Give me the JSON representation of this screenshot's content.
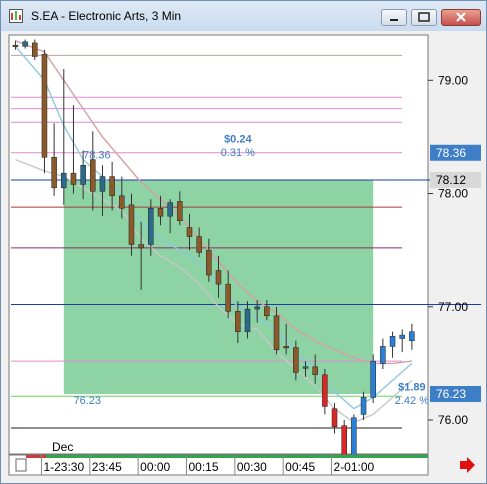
{
  "window": {
    "title": "S.EA - Electronic Arts, 3 Min",
    "minimize_icon": "minimize-icon",
    "maximize_icon": "maximize-icon",
    "close_icon": "close-icon"
  },
  "chart_data": {
    "type": "candlestick",
    "title": "S.EA - Electronic Arts, 3 Min",
    "ylim": [
      75.7,
      79.4
    ],
    "y_ticks": [
      79.0,
      78.0,
      77.0,
      76.0
    ],
    "y_tick_labels": [
      "79.00",
      "78.00",
      "77.00",
      "76.00"
    ],
    "x_labels": [
      "1-23:30",
      "23:45",
      "00:00",
      "00:15",
      "00:30",
      "00:45",
      "2-01:00"
    ],
    "x_label_positions": [
      0,
      15,
      30,
      45,
      60,
      75,
      90
    ],
    "month_label": "Dec",
    "price_badges": [
      {
        "label": "78.36",
        "value": 78.36,
        "color": "#3d7ec6",
        "text_color": "#ffffff"
      },
      {
        "label": "78.12",
        "value": 78.12,
        "color": "#d8d8d8",
        "text_color": "#000000"
      },
      {
        "label": "76.23",
        "value": 76.23,
        "color": "#3d7ec6",
        "text_color": "#ffffff"
      }
    ],
    "horizontal_lines": [
      {
        "value": 79.22,
        "color": "#c0a0a0"
      },
      {
        "value": 78.85,
        "color": "#e08ad0"
      },
      {
        "value": 78.75,
        "color": "#e08ad0"
      },
      {
        "value": 78.63,
        "color": "#e08ad0"
      },
      {
        "value": 78.36,
        "color": "#e08ad0"
      },
      {
        "value": 78.12,
        "color": "#1c3aa8"
      },
      {
        "value": 77.88,
        "color": "#a33a3a"
      },
      {
        "value": 77.52,
        "color": "#8a2b6a"
      },
      {
        "value": 77.02,
        "color": "#1c3aa8"
      },
      {
        "value": 76.52,
        "color": "#e08ad0"
      },
      {
        "value": 76.21,
        "color": "#6ecf5a"
      },
      {
        "value": 75.93,
        "color": "#222222"
      },
      {
        "value": 75.63,
        "color": "#c94040"
      }
    ],
    "annotations": [
      {
        "text": "$0.24",
        "x": 60,
        "y": 78.45,
        "color": "#3d7ec6"
      },
      {
        "text": "0.31 %",
        "x": 60,
        "y": 78.33,
        "color": "#3d7ec6"
      },
      {
        "text": "78.36",
        "x": 12,
        "y": 78.31,
        "color": "#3d7ec6"
      },
      {
        "text": "76.23",
        "x": 9,
        "y": 76.14,
        "color": "#3d7ec6"
      },
      {
        "text": "$1.89",
        "x": 114,
        "y": 76.26,
        "color": "#3d7ec6"
      },
      {
        "text": "2.42 %",
        "x": 114,
        "y": 76.14,
        "color": "#3d7ec6"
      }
    ],
    "range_box": {
      "x_start": 6,
      "x_end": 102,
      "y_top": 78.12,
      "y_bottom": 76.23,
      "color": "#5cc07c"
    },
    "candles": [
      {
        "x": -9,
        "open": 79.31,
        "high": 79.35,
        "low": 79.27,
        "close": 79.3
      },
      {
        "x": -6,
        "open": 79.3,
        "high": 79.36,
        "low": 79.28,
        "close": 79.34
      },
      {
        "x": -3,
        "open": 79.33,
        "high": 79.36,
        "low": 79.18,
        "close": 79.21
      },
      {
        "x": 0,
        "open": 79.23,
        "high": 79.27,
        "low": 78.18,
        "close": 78.32
      },
      {
        "x": 3,
        "open": 78.32,
        "high": 78.62,
        "low": 77.98,
        "close": 78.05
      },
      {
        "x": 6,
        "open": 78.05,
        "high": 79.1,
        "low": 77.9,
        "close": 78.18
      },
      {
        "x": 9,
        "open": 78.18,
        "high": 78.78,
        "low": 78.0,
        "close": 78.08
      },
      {
        "x": 12,
        "open": 78.08,
        "high": 78.38,
        "low": 77.95,
        "close": 78.25
      },
      {
        "x": 15,
        "open": 78.3,
        "high": 78.55,
        "low": 77.85,
        "close": 78.02
      },
      {
        "x": 18,
        "open": 78.02,
        "high": 78.25,
        "low": 77.8,
        "close": 78.15
      },
      {
        "x": 21,
        "open": 78.15,
        "high": 78.28,
        "low": 77.85,
        "close": 77.98
      },
      {
        "x": 24,
        "open": 77.98,
        "high": 78.15,
        "low": 77.78,
        "close": 77.87
      },
      {
        "x": 27,
        "open": 77.9,
        "high": 78.0,
        "low": 77.45,
        "close": 77.55
      },
      {
        "x": 30,
        "open": 77.55,
        "high": 77.75,
        "low": 77.15,
        "close": 77.52
      },
      {
        "x": 33,
        "open": 77.55,
        "high": 77.95,
        "low": 77.45,
        "close": 77.87
      },
      {
        "x": 36,
        "open": 77.87,
        "high": 77.98,
        "low": 77.72,
        "close": 77.8
      },
      {
        "x": 39,
        "open": 77.8,
        "high": 77.95,
        "low": 77.65,
        "close": 77.92
      },
      {
        "x": 42,
        "open": 77.93,
        "high": 78.02,
        "low": 77.72,
        "close": 77.76
      },
      {
        "x": 45,
        "open": 77.7,
        "high": 77.82,
        "low": 77.5,
        "close": 77.62
      },
      {
        "x": 48,
        "open": 77.62,
        "high": 77.7,
        "low": 77.44,
        "close": 77.48
      },
      {
        "x": 51,
        "open": 77.5,
        "high": 77.6,
        "low": 77.22,
        "close": 77.28
      },
      {
        "x": 54,
        "open": 77.32,
        "high": 77.45,
        "low": 77.08,
        "close": 77.2
      },
      {
        "x": 57,
        "open": 77.2,
        "high": 77.32,
        "low": 76.9,
        "close": 76.96
      },
      {
        "x": 60,
        "open": 76.96,
        "high": 77.05,
        "low": 76.68,
        "close": 76.78
      },
      {
        "x": 63,
        "open": 76.78,
        "high": 77.05,
        "low": 76.72,
        "close": 76.98
      },
      {
        "x": 66,
        "open": 76.98,
        "high": 77.06,
        "low": 76.86,
        "close": 77.0
      },
      {
        "x": 69,
        "open": 77.0,
        "high": 77.06,
        "low": 76.88,
        "close": 76.92
      },
      {
        "x": 72,
        "open": 76.92,
        "high": 77.0,
        "low": 76.58,
        "close": 76.62
      },
      {
        "x": 75,
        "open": 76.65,
        "high": 76.85,
        "low": 76.58,
        "close": 76.64
      },
      {
        "x": 78,
        "open": 76.64,
        "high": 76.7,
        "low": 76.35,
        "close": 76.42
      },
      {
        "x": 81,
        "open": 76.46,
        "high": 76.52,
        "low": 76.38,
        "close": 76.47
      },
      {
        "x": 84,
        "open": 76.47,
        "high": 76.58,
        "low": 76.32,
        "close": 76.4
      },
      {
        "x": 87,
        "open": 76.4,
        "high": 76.45,
        "low": 76.05,
        "close": 76.12
      },
      {
        "x": 90,
        "open": 76.1,
        "high": 76.15,
        "low": 75.88,
        "close": 75.94
      },
      {
        "x": 93,
        "open": 75.95,
        "high": 76.0,
        "low": 75.6,
        "close": 75.65
      },
      {
        "x": 96,
        "open": 75.66,
        "high": 76.05,
        "low": 75.6,
        "close": 76.02
      },
      {
        "x": 99,
        "open": 76.05,
        "high": 76.25,
        "low": 76.0,
        "close": 76.2
      },
      {
        "x": 102,
        "open": 76.2,
        "high": 76.58,
        "low": 76.15,
        "close": 76.52
      },
      {
        "x": 105,
        "open": 76.5,
        "high": 76.72,
        "low": 76.45,
        "close": 76.65
      },
      {
        "x": 108,
        "open": 76.65,
        "high": 76.78,
        "low": 76.55,
        "close": 76.74
      },
      {
        "x": 111,
        "open": 76.72,
        "high": 76.8,
        "low": 76.6,
        "close": 76.75
      },
      {
        "x": 114,
        "open": 76.7,
        "high": 76.85,
        "low": 76.62,
        "close": 76.78
      }
    ],
    "moving_averages": [
      {
        "name": "",
        "color": "#8ec8e0",
        "values": [
          [
            -9,
            79.3
          ],
          [
            0,
            79.0
          ],
          [
            6,
            78.6
          ],
          [
            12,
            78.3
          ],
          [
            18,
            78.15
          ],
          [
            24,
            78.0
          ],
          [
            30,
            77.75
          ],
          [
            36,
            77.6
          ],
          [
            42,
            77.5
          ],
          [
            48,
            77.4
          ],
          [
            54,
            77.2
          ],
          [
            60,
            77.0
          ],
          [
            66,
            76.9
          ],
          [
            72,
            76.8
          ],
          [
            78,
            76.6
          ],
          [
            84,
            76.45
          ],
          [
            90,
            76.25
          ],
          [
            96,
            76.1
          ],
          [
            102,
            76.2
          ],
          [
            108,
            76.35
          ],
          [
            114,
            76.5
          ]
        ]
      },
      {
        "name": "",
        "color": "#d4a0a4",
        "values": [
          [
            -9,
            79.35
          ],
          [
            0,
            79.25
          ],
          [
            6,
            79.0
          ],
          [
            12,
            78.75
          ],
          [
            18,
            78.5
          ],
          [
            24,
            78.3
          ],
          [
            30,
            78.1
          ],
          [
            36,
            77.95
          ],
          [
            42,
            77.8
          ],
          [
            48,
            77.6
          ],
          [
            54,
            77.4
          ],
          [
            60,
            77.2
          ],
          [
            66,
            77.05
          ],
          [
            72,
            76.95
          ],
          [
            78,
            76.8
          ],
          [
            84,
            76.7
          ],
          [
            90,
            76.62
          ],
          [
            96,
            76.55
          ],
          [
            102,
            76.5
          ],
          [
            108,
            76.5
          ],
          [
            114,
            76.52
          ]
        ]
      },
      {
        "name": "",
        "color": "#c8c8c8",
        "values": [
          [
            -9,
            78.3
          ],
          [
            0,
            78.2
          ],
          [
            6,
            78.15
          ],
          [
            12,
            78.05
          ],
          [
            18,
            77.95
          ],
          [
            24,
            77.85
          ],
          [
            30,
            77.6
          ],
          [
            36,
            77.45
          ],
          [
            42,
            77.35
          ],
          [
            48,
            77.2
          ],
          [
            54,
            77.0
          ],
          [
            60,
            76.85
          ],
          [
            66,
            76.8
          ],
          [
            72,
            76.6
          ],
          [
            78,
            76.45
          ],
          [
            84,
            76.3
          ],
          [
            90,
            76.1
          ],
          [
            96,
            75.98
          ],
          [
            102,
            76.05
          ],
          [
            108,
            76.2
          ],
          [
            114,
            76.35
          ]
        ]
      }
    ]
  },
  "footer": {
    "nav_arrow_icon": "red-arrow-right-icon"
  }
}
